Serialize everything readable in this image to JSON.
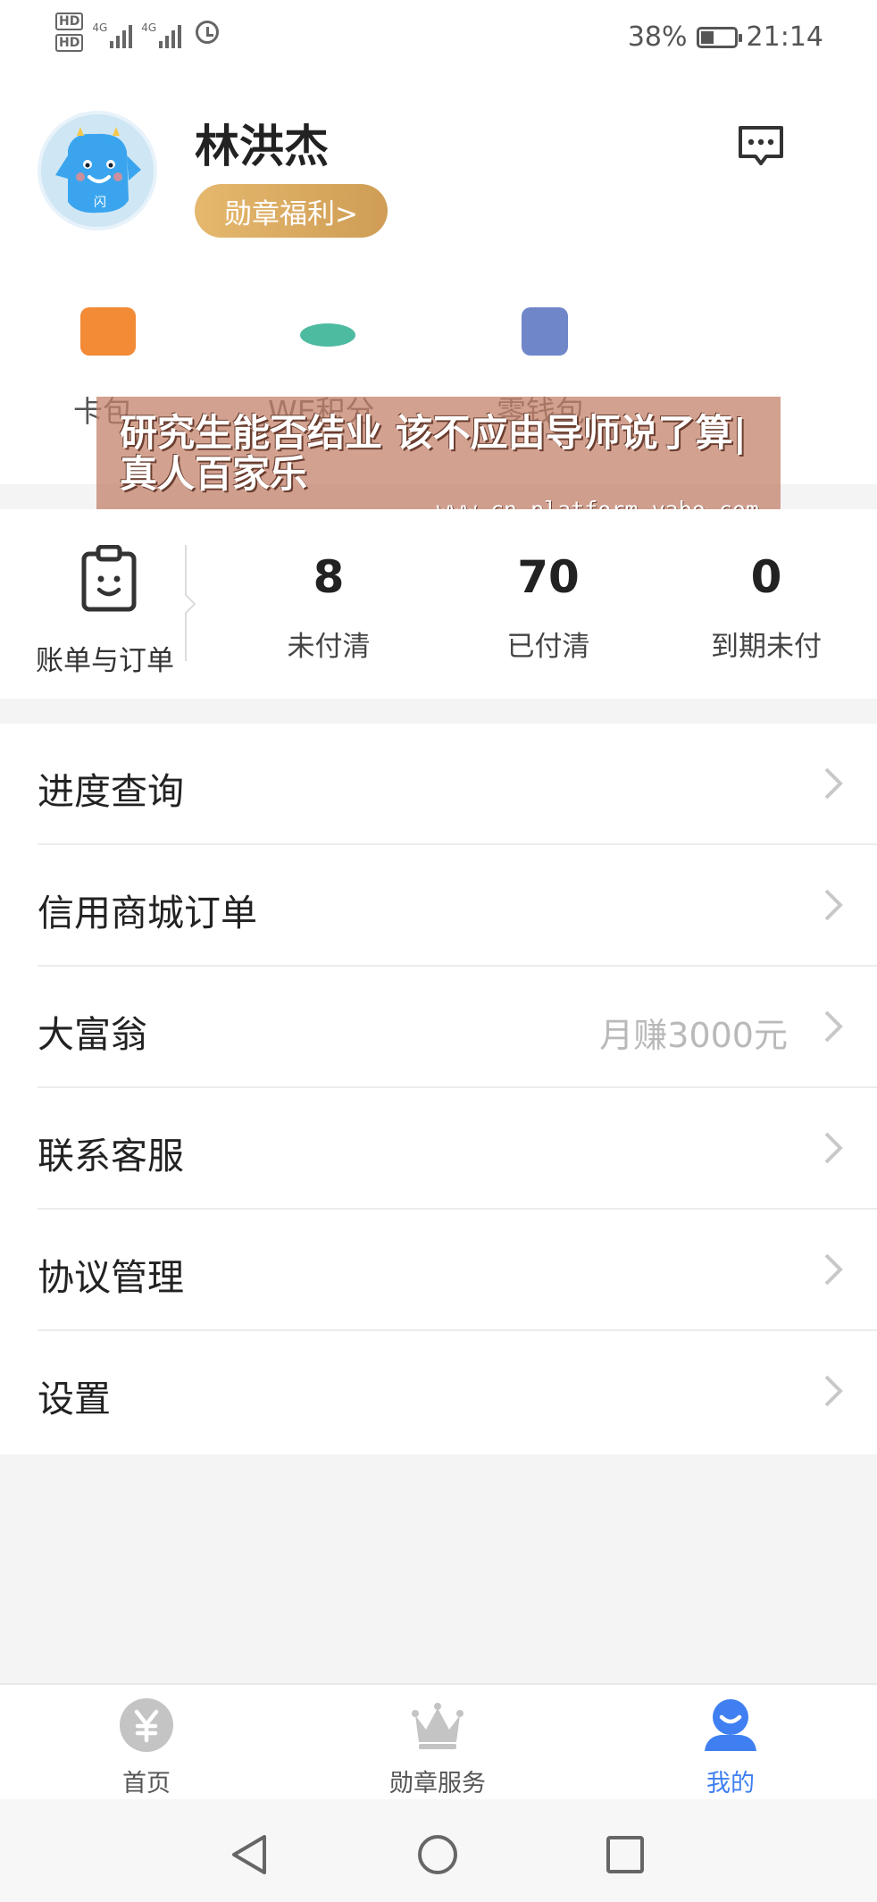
{
  "status_bar": {
    "hd1": "HD",
    "hd2": "HD",
    "net1": "4G",
    "net2": "4G",
    "battery_percent": "38%",
    "battery_level": 0.38,
    "time": "21:14"
  },
  "profile": {
    "username": "林洪杰",
    "medal_button": "勋章福利>",
    "avatar_badge": "闪"
  },
  "shortcuts": [
    {
      "label": "卡包",
      "icon": "card-wallet-icon",
      "color": "#f28a36"
    },
    {
      "label": "WE积分",
      "icon": "points-icon",
      "color": "#4dbba0"
    },
    {
      "label": "零钱包",
      "icon": "change-wallet-icon",
      "color": "#6f86c9"
    }
  ],
  "banner": {
    "title": "研究生能否结业 该不应由导师说了算|真人百家乐",
    "url": "www.cn-platform-yabo.com"
  },
  "bill": {
    "label": "账单与订单",
    "stats": [
      {
        "value": "8",
        "label": "未付清"
      },
      {
        "value": "70",
        "label": "已付清"
      },
      {
        "value": "0",
        "label": "到期未付"
      }
    ]
  },
  "menu": [
    {
      "label": "进度查询",
      "extra": ""
    },
    {
      "label": "信用商城订单",
      "extra": ""
    },
    {
      "label": "大富翁",
      "extra": "月赚3000元"
    },
    {
      "label": "联系客服",
      "extra": ""
    },
    {
      "label": "协议管理",
      "extra": ""
    },
    {
      "label": "设置",
      "extra": ""
    }
  ],
  "tabs": [
    {
      "label": "首页",
      "icon": "yen-icon",
      "active": false
    },
    {
      "label": "勋章服务",
      "icon": "crown-icon",
      "active": false
    },
    {
      "label": "我的",
      "icon": "profile-icon",
      "active": true
    }
  ],
  "colors": {
    "accent": "#3f7ff1",
    "medal_gold": "#dcab62",
    "chevron": "#c8c8c8"
  }
}
